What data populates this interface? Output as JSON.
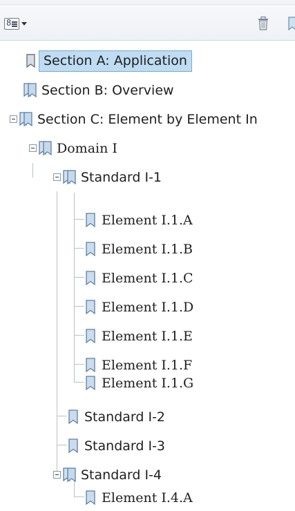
{
  "toolbar": {
    "options_icon": "options-menu-icon",
    "options_digit": "8",
    "trash_icon": "trash-icon"
  },
  "tree": {
    "items": [
      {
        "label": "Section A: Application",
        "selected": true,
        "icon": "bookmark-icon"
      },
      {
        "label": "Section B:  Overview",
        "icon": "bookmark-double-icon"
      },
      {
        "label": "Section C: Element by Element In",
        "icon": "bookmark-double-icon",
        "expanded": true
      },
      {
        "label": "Domain I",
        "icon": "bookmark-double-icon",
        "expanded": true
      },
      {
        "label": "Standard I-1",
        "icon": "bookmark-double-icon",
        "expanded": true
      },
      {
        "label": "Element I.1.A",
        "icon": "bookmark-icon"
      },
      {
        "label": "Element I.1.B",
        "icon": "bookmark-icon"
      },
      {
        "label": "Element I.1.C",
        "icon": "bookmark-icon"
      },
      {
        "label": "Element I.1.D",
        "icon": "bookmark-icon"
      },
      {
        "label": "Element I.1.E",
        "icon": "bookmark-icon"
      },
      {
        "label": "Element I.1.F",
        "icon": "bookmark-icon"
      },
      {
        "label": "Element I.1.G",
        "icon": "bookmark-icon"
      },
      {
        "label": "Standard I-2",
        "icon": "bookmark-icon"
      },
      {
        "label": "Standard I-3",
        "icon": "bookmark-icon"
      },
      {
        "label": "Standard I-4",
        "icon": "bookmark-double-icon",
        "expanded": true
      },
      {
        "label": "Element I.4.A",
        "icon": "bookmark-icon"
      }
    ]
  },
  "colors": {
    "selection_fill": "#bfdcf2",
    "selection_border": "#7aa9d1",
    "icon_fill": "#8fb0d0"
  }
}
